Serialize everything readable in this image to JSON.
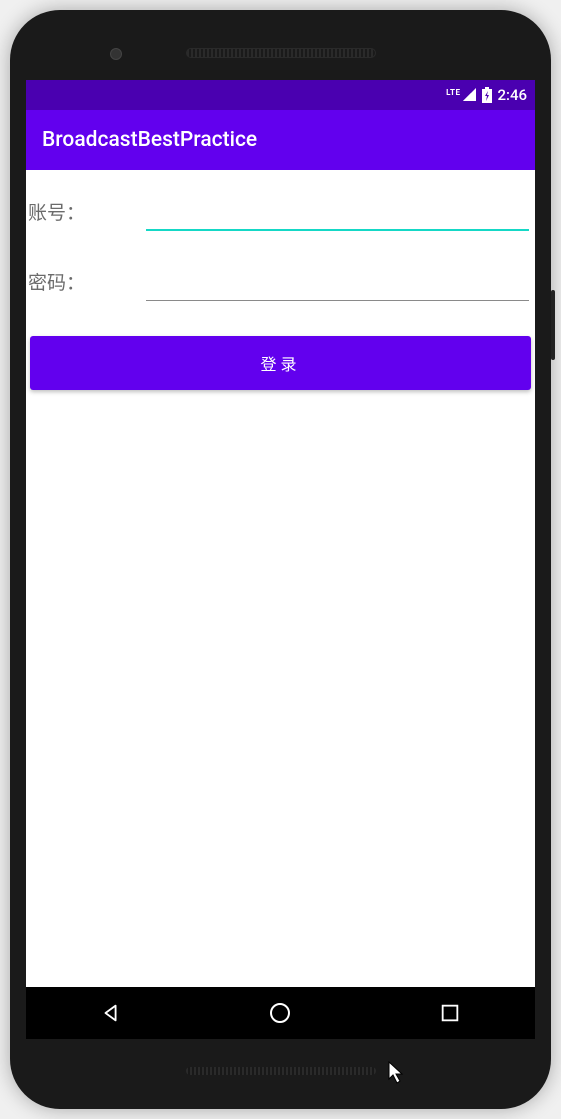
{
  "status_bar": {
    "network_label": "LTE",
    "time": "2:46"
  },
  "app_bar": {
    "title": "BroadcastBestPractice"
  },
  "form": {
    "account_label": "账号：",
    "account_value": "",
    "password_label": "密码：",
    "password_value": ""
  },
  "buttons": {
    "login_label": "登录"
  },
  "colors": {
    "status_bar": "#4a00b0",
    "primary": "#6200ee",
    "accent": "#15d8c6"
  }
}
